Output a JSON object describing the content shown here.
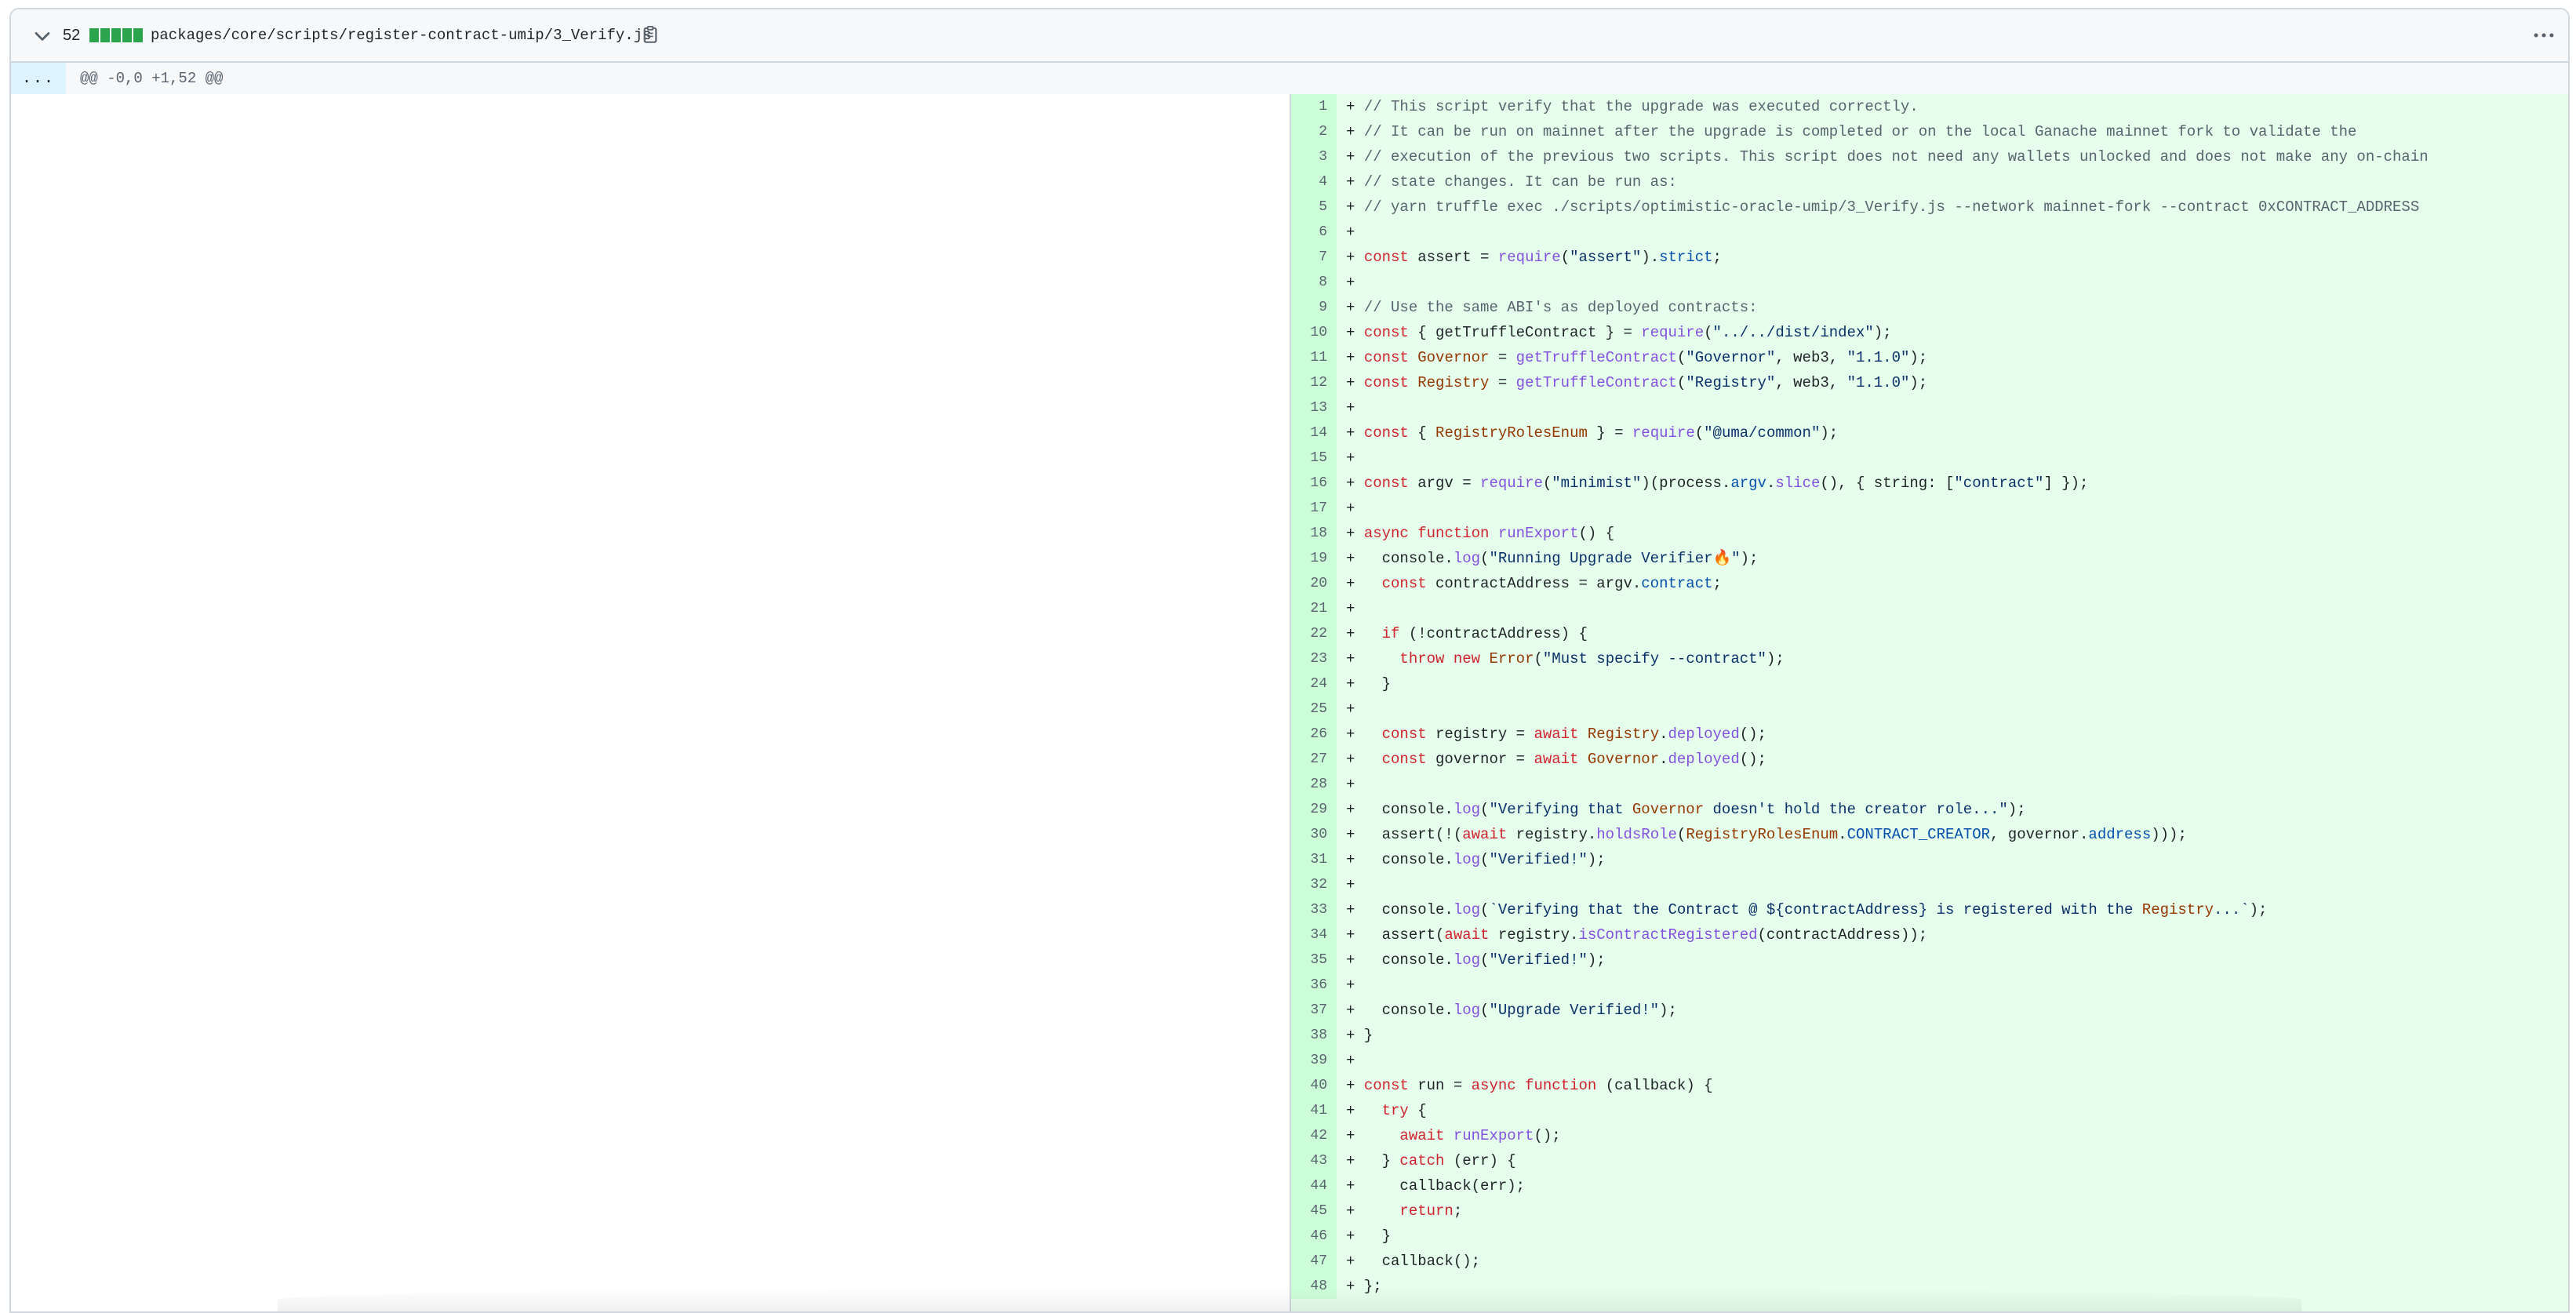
{
  "file": {
    "lines_changed": "52",
    "path": "packages/core/scripts/register-contract-umip/3_Verify.js"
  },
  "hunk": {
    "expand_label": "...",
    "header": "@@ -0,0 +1,52 @@"
  },
  "colors": {
    "addition_bg": "#e6ffec",
    "addition_num_bg": "#ccffd8",
    "diffstat_green": "#2da44e",
    "hunk_bg": "#ddf4ff"
  },
  "lines": [
    {
      "num": "1",
      "code": "+ // This script verify that the upgrade was executed correctly."
    },
    {
      "num": "2",
      "code": "+ // It can be run on mainnet after the upgrade is completed or on the local Ganache mainnet fork to validate the"
    },
    {
      "num": "3",
      "code": "+ // execution of the previous two scripts. This script does not need any wallets unlocked and does not make any on-chain"
    },
    {
      "num": "4",
      "code": "+ // state changes. It can be run as:"
    },
    {
      "num": "5",
      "code": "+ // yarn truffle exec ./scripts/optimistic-oracle-umip/3_Verify.js --network mainnet-fork --contract 0xCONTRACT_ADDRESS"
    },
    {
      "num": "6",
      "code": "+"
    },
    {
      "num": "7",
      "code": "+ const assert = require(\"assert\").strict;"
    },
    {
      "num": "8",
      "code": "+"
    },
    {
      "num": "9",
      "code": "+ // Use the same ABI's as deployed contracts:"
    },
    {
      "num": "10",
      "code": "+ const { getTruffleContract } = require(\"../../dist/index\");"
    },
    {
      "num": "11",
      "code": "+ const Governor = getTruffleContract(\"Governor\", web3, \"1.1.0\");"
    },
    {
      "num": "12",
      "code": "+ const Registry = getTruffleContract(\"Registry\", web3, \"1.1.0\");"
    },
    {
      "num": "13",
      "code": "+"
    },
    {
      "num": "14",
      "code": "+ const { RegistryRolesEnum } = require(\"@uma/common\");"
    },
    {
      "num": "15",
      "code": "+"
    },
    {
      "num": "16",
      "code": "+ const argv = require(\"minimist\")(process.argv.slice(), { string: [\"contract\"] });"
    },
    {
      "num": "17",
      "code": "+"
    },
    {
      "num": "18",
      "code": "+ async function runExport() {"
    },
    {
      "num": "19",
      "code": "+   console.log(\"Running Upgrade Verifier🔥\");"
    },
    {
      "num": "20",
      "code": "+   const contractAddress = argv.contract;"
    },
    {
      "num": "21",
      "code": "+"
    },
    {
      "num": "22",
      "code": "+   if (!contractAddress) {"
    },
    {
      "num": "23",
      "code": "+     throw new Error(\"Must specify --contract\");"
    },
    {
      "num": "24",
      "code": "+   }"
    },
    {
      "num": "25",
      "code": "+"
    },
    {
      "num": "26",
      "code": "+   const registry = await Registry.deployed();"
    },
    {
      "num": "27",
      "code": "+   const governor = await Governor.deployed();"
    },
    {
      "num": "28",
      "code": "+"
    },
    {
      "num": "29",
      "code": "+   console.log(\"Verifying that Governor doesn't hold the creator role...\");"
    },
    {
      "num": "30",
      "code": "+   assert(!(await registry.holdsRole(RegistryRolesEnum.CONTRACT_CREATOR, governor.address)));"
    },
    {
      "num": "31",
      "code": "+   console.log(\"Verified!\");"
    },
    {
      "num": "32",
      "code": "+"
    },
    {
      "num": "33",
      "code": "+   console.log(`Verifying that the Contract @ ${contractAddress} is registered with the Registry...`);"
    },
    {
      "num": "34",
      "code": "+   assert(await registry.isContractRegistered(contractAddress));"
    },
    {
      "num": "35",
      "code": "+   console.log(\"Verified!\");"
    },
    {
      "num": "36",
      "code": "+"
    },
    {
      "num": "37",
      "code": "+   console.log(\"Upgrade Verified!\");"
    },
    {
      "num": "38",
      "code": "+ }"
    },
    {
      "num": "39",
      "code": "+"
    },
    {
      "num": "40",
      "code": "+ const run = async function (callback) {"
    },
    {
      "num": "41",
      "code": "+   try {"
    },
    {
      "num": "42",
      "code": "+     await runExport();"
    },
    {
      "num": "43",
      "code": "+   } catch (err) {"
    },
    {
      "num": "44",
      "code": "+     callback(err);"
    },
    {
      "num": "45",
      "code": "+     return;"
    },
    {
      "num": "46",
      "code": "+   }"
    },
    {
      "num": "47",
      "code": "+   callback();"
    },
    {
      "num": "48",
      "code": "+ };"
    }
  ]
}
